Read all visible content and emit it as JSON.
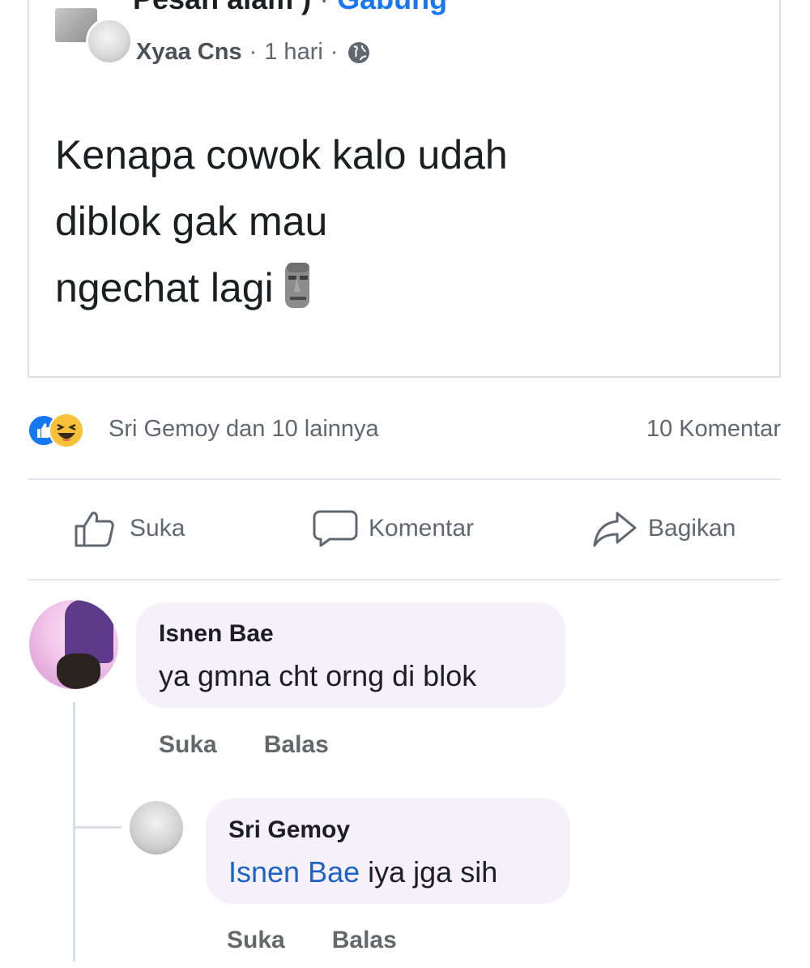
{
  "post": {
    "header_group": "Pesan alam )",
    "header_separator": "·",
    "header_join": "Gabung",
    "author": "Xyaa Cns",
    "meta_separator": "·",
    "time": "1 hari",
    "privacy_icon": "globe-icon",
    "text_lines": [
      "Kenapa cowok kalo udah",
      "diblok gak mau",
      "ngechat lagi"
    ],
    "emoji": "moai-icon"
  },
  "reactions": {
    "icons": [
      "like-icon",
      "haha-icon"
    ],
    "summary": "Sri Gemoy dan 10 lainnya",
    "comment_count": "10 Komentar"
  },
  "actions": {
    "like": "Suka",
    "comment": "Komentar",
    "share": "Bagikan"
  },
  "comments": [
    {
      "author": "Isnen Bae",
      "text": "ya gmna cht orng di blok",
      "like": "Suka",
      "reply": "Balas",
      "replies": [
        {
          "author": "Sri Gemoy",
          "mention": "Isnen Bae",
          "text": " iya jga sih",
          "like": "Suka",
          "reply": "Balas"
        }
      ]
    }
  ],
  "colors": {
    "link": "#1877f2",
    "mention": "#1d63c6",
    "secondary_text": "#606770",
    "bubble": "#f5f0fa"
  }
}
